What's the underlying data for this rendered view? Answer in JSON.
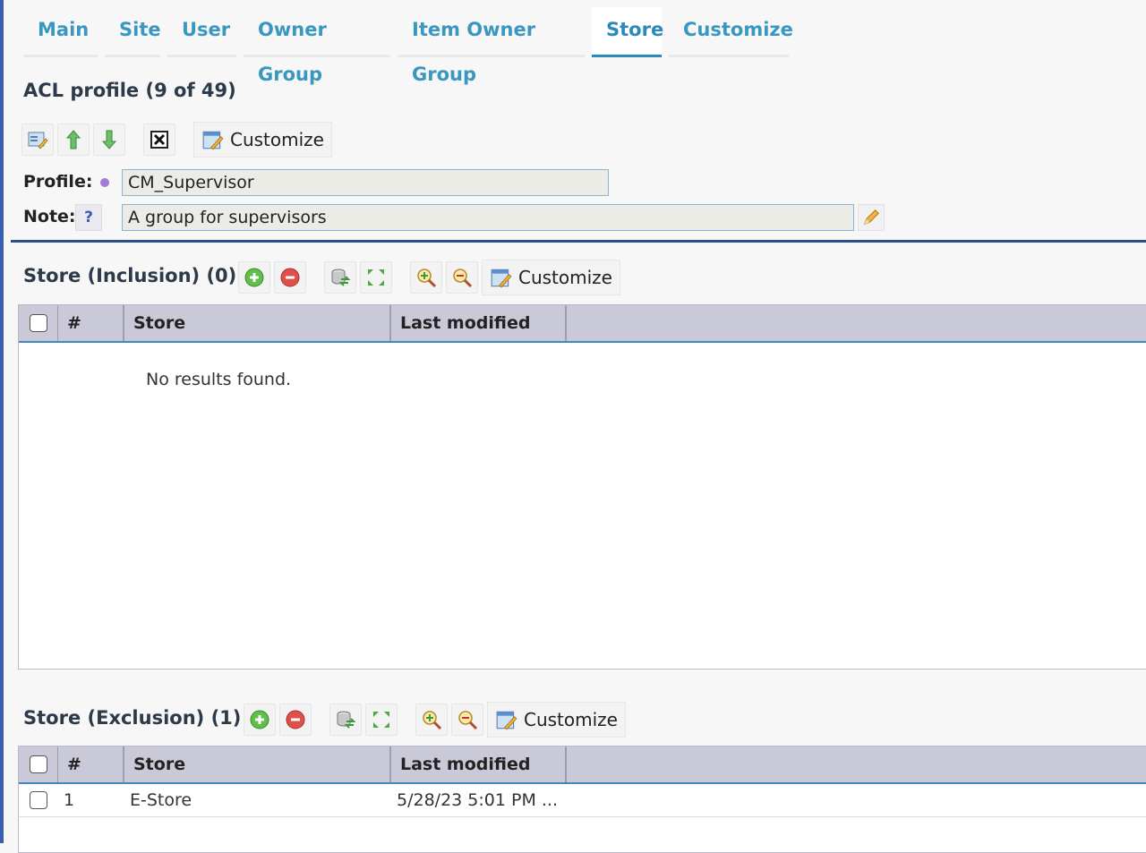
{
  "tabs": [
    {
      "label": "Main"
    },
    {
      "label": "Site"
    },
    {
      "label": "User"
    },
    {
      "label": "Owner Group"
    },
    {
      "label": "Item Owner Group"
    },
    {
      "label": "Store",
      "active": true
    },
    {
      "label": "Customize"
    }
  ],
  "acl": {
    "title": "ACL profile (9 of 49)",
    "customize_label": "Customize",
    "profile_label": "Profile:",
    "profile_value": "CM_Supervisor",
    "note_label": "Note:",
    "note_help": "?",
    "note_value": "A group for supervisors"
  },
  "inclusion": {
    "title": "Store (Inclusion) (0)",
    "customize_label": "Customize",
    "columns": [
      "#",
      "Store",
      "Last modified"
    ],
    "empty_message": "No results found."
  },
  "exclusion": {
    "title": "Store (Exclusion) (1)",
    "customize_label": "Customize",
    "columns": [
      "#",
      "Store",
      "Last modified"
    ],
    "rows": [
      {
        "num": "1",
        "store": "E-Store",
        "modified": "5/28/23 5:01 PM ..."
      }
    ]
  },
  "colors": {
    "accent": "#2a8ab8",
    "header_bg": "#c9c9d8",
    "divider": "#2b4f8a"
  }
}
